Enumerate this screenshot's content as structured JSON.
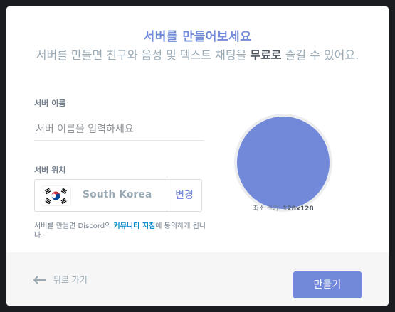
{
  "modal": {
    "title": "서버를 만들어보세요",
    "subtitle_before": "서버를 만들면 친구와 음성 및 텍스트 채팅을 ",
    "subtitle_bold": "무료로",
    "subtitle_after": " 즐길 수 있어요."
  },
  "server_name": {
    "label": "서버 이름",
    "placeholder": "서버 이름을 입력하세요",
    "value": ""
  },
  "server_region": {
    "label": "서버 위치",
    "region_name": "South Korea",
    "change_label": "변경"
  },
  "terms": {
    "before": "서버를 만들면 Discord의 ",
    "link": "커뮤니티 지침",
    "after": "에 동의하게 됩니다."
  },
  "icon": {
    "min_size_label": "최소 크기:",
    "min_size_value": "128x128",
    "color": "#7289da"
  },
  "footer": {
    "back_label": "뒤로 가기",
    "create_label": "만들기"
  },
  "colors": {
    "accent": "#7289da",
    "link": "#0088cc"
  }
}
